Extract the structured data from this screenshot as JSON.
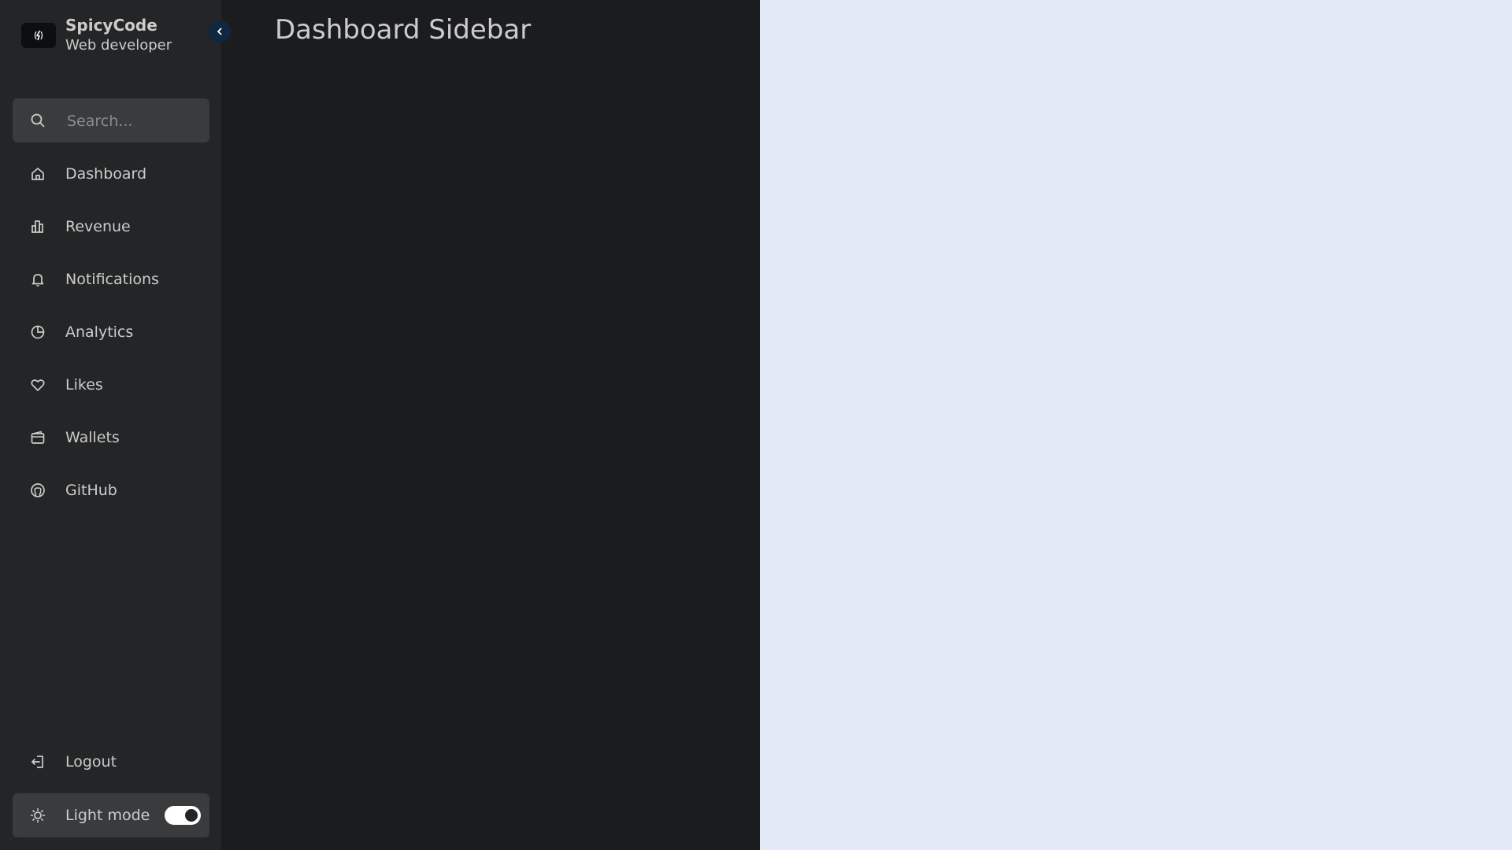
{
  "brand": {
    "name": "SpicyCode",
    "role": "Web developer"
  },
  "search": {
    "placeholder": "Search..."
  },
  "nav": {
    "items": [
      {
        "label": "Dashboard",
        "icon": "home-icon"
      },
      {
        "label": "Revenue",
        "icon": "bar-chart-icon"
      },
      {
        "label": "Notifications",
        "icon": "bell-icon"
      },
      {
        "label": "Analytics",
        "icon": "pie-chart-icon"
      },
      {
        "label": "Likes",
        "icon": "heart-icon"
      },
      {
        "label": "Wallets",
        "icon": "wallet-icon"
      },
      {
        "label": "GitHub",
        "icon": "github-icon"
      }
    ]
  },
  "footer": {
    "logout_label": "Logout",
    "mode_label": "Light mode",
    "mode_toggle_on": true
  },
  "main": {
    "title": "Dashboard Sidebar"
  },
  "colors": {
    "sidebar_bg": "#242526",
    "main_bg": "#1b1c1e",
    "page_bg": "#e3e9f7",
    "text": "#cccccc",
    "search_bg": "#3a3b3c"
  }
}
